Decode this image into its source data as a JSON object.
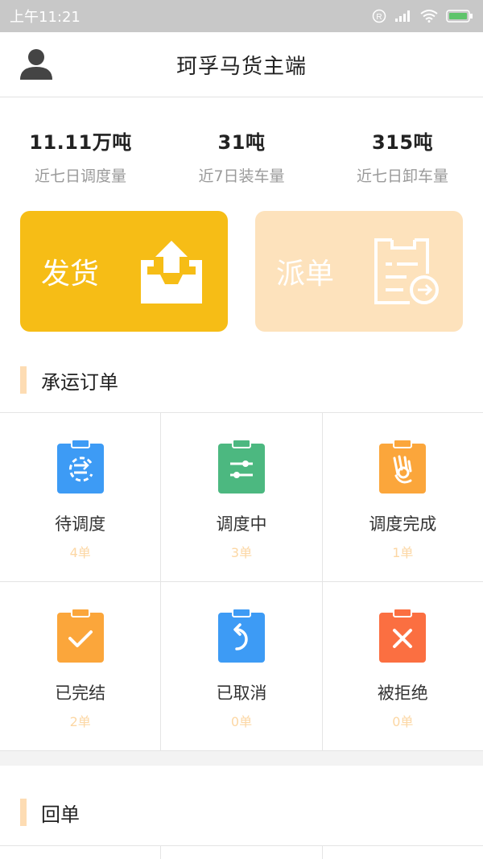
{
  "status_bar": {
    "time": "上午11:21"
  },
  "header": {
    "title": "珂孚马货主端"
  },
  "stats": [
    {
      "value": "11.11万吨",
      "label": "近七日调度量"
    },
    {
      "value": "31吨",
      "label": "近7日装车量"
    },
    {
      "value": "315吨",
      "label": "近七日卸车量"
    }
  ],
  "actions": {
    "ship": {
      "label": "发货",
      "color": "#f6bd16"
    },
    "dispatch": {
      "label": "派单",
      "color": "#fde2bc"
    }
  },
  "orders_section": {
    "title": "承运订单",
    "items": [
      {
        "label": "待调度",
        "count": "4单",
        "color": "#3d9bf5",
        "icon": "schedule-icon"
      },
      {
        "label": "调度中",
        "count": "3单",
        "color": "#4cb880",
        "icon": "sliders-icon"
      },
      {
        "label": "调度完成",
        "count": "1单",
        "color": "#fba63b",
        "icon": "ok-hand-icon"
      },
      {
        "label": "已完结",
        "count": "2单",
        "color": "#fba63b",
        "icon": "check-icon"
      },
      {
        "label": "已取消",
        "count": "0单",
        "color": "#3d9bf5",
        "icon": "undo-icon"
      },
      {
        "label": "被拒绝",
        "count": "0单",
        "color": "#fb6f41",
        "icon": "close-icon"
      }
    ]
  },
  "receipt_section": {
    "title": "回单"
  }
}
